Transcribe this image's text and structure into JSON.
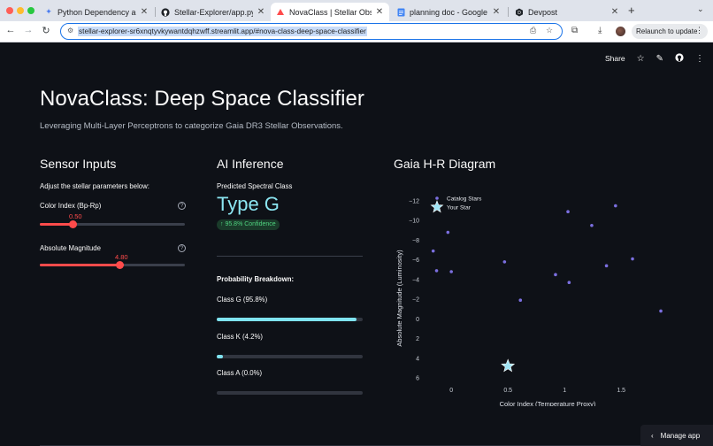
{
  "browser": {
    "tabs": [
      {
        "title": "Python Dependency and Envi",
        "icon": "gemini-icon"
      },
      {
        "title": "Stellar-Explorer/app.py at ma",
        "icon": "github-icon"
      },
      {
        "title": "NovaClass | Stellar Observati",
        "icon": "streamlit-icon"
      },
      {
        "title": "planning doc - Google Docs",
        "icon": "docs-icon"
      },
      {
        "title": "Devpost",
        "icon": "devpost-icon"
      }
    ],
    "url": "stellar-explorer-sr6xnqtyvkywantdqhzwff.streamlit.app/#nova-class-deep-space-classifier",
    "relaunch_label": "Relaunch to update"
  },
  "app_header": {
    "share_label": "Share"
  },
  "page": {
    "title": "NovaClass: Deep Space Classifier",
    "subtitle": "Leveraging Multi-Layer Perceptrons to categorize Gaia DR3 Stellar Observations."
  },
  "sensor": {
    "heading": "Sensor Inputs",
    "instruction": "Adjust the stellar parameters below:",
    "sliders": [
      {
        "label": "Color Index (Bp-Rp)",
        "value": "0.50",
        "fraction": 0.23
      },
      {
        "label": "Absolute Magnitude",
        "value": "4.80",
        "fraction": 0.55
      }
    ]
  },
  "inference": {
    "heading": "AI Inference",
    "predicted_label": "Predicted Spectral Class",
    "predicted_class": "Type G",
    "confidence": "↑ 95.8% Confidence",
    "breakdown_title": "Probability Breakdown:",
    "classes": [
      {
        "label": "Class G (95.8%)",
        "fraction": 0.958
      },
      {
        "label": "Class K (4.2%)",
        "fraction": 0.042
      },
      {
        "label": "Class A (0.0%)",
        "fraction": 0.0
      }
    ]
  },
  "chart_heading": "Gaia H-R Diagram",
  "chart_data": {
    "type": "scatter",
    "xlabel": "Color Index (Temperature Proxy)",
    "ylabel": "Absolute Magnitude (Luminosity)",
    "xlim": [
      -0.22,
      1.92
    ],
    "ylim": [
      6,
      -12
    ],
    "y_inverted": true,
    "x_ticks": [
      0,
      0.5,
      1,
      1.5
    ],
    "x_tick_labels": [
      "0",
      "0.5",
      "1",
      "1.5"
    ],
    "y_ticks": [
      -12,
      -10,
      -8,
      -6,
      -4,
      -2,
      0,
      2,
      4,
      6
    ],
    "y_tick_labels": [
      "−12",
      "−10",
      "−8",
      "−6",
      "−4",
      "−2",
      "0",
      "2",
      "4",
      "6"
    ],
    "legend": [
      "Catalog Stars",
      "Your Star"
    ],
    "legend_position": "top-left",
    "series": [
      {
        "name": "Catalog Stars",
        "color": "#7b6fe0",
        "points": [
          [
            -0.16,
            -6.9
          ],
          [
            -0.13,
            -4.9
          ],
          [
            -0.03,
            -8.8
          ],
          [
            0.0,
            -4.8
          ],
          [
            0.47,
            -5.8
          ],
          [
            0.61,
            -1.9
          ],
          [
            0.92,
            -4.5
          ],
          [
            1.03,
            -10.9
          ],
          [
            1.04,
            -3.7
          ],
          [
            1.24,
            -9.5
          ],
          [
            1.37,
            -5.4
          ],
          [
            1.45,
            -11.5
          ],
          [
            1.6,
            -6.1
          ],
          [
            1.85,
            -0.8
          ]
        ]
      },
      {
        "name": "Your Star",
        "color": "#9fe4f5",
        "marker": "star",
        "points": [
          [
            0.5,
            4.8
          ]
        ]
      }
    ]
  },
  "footer": {
    "manage_label": "Manage app"
  }
}
